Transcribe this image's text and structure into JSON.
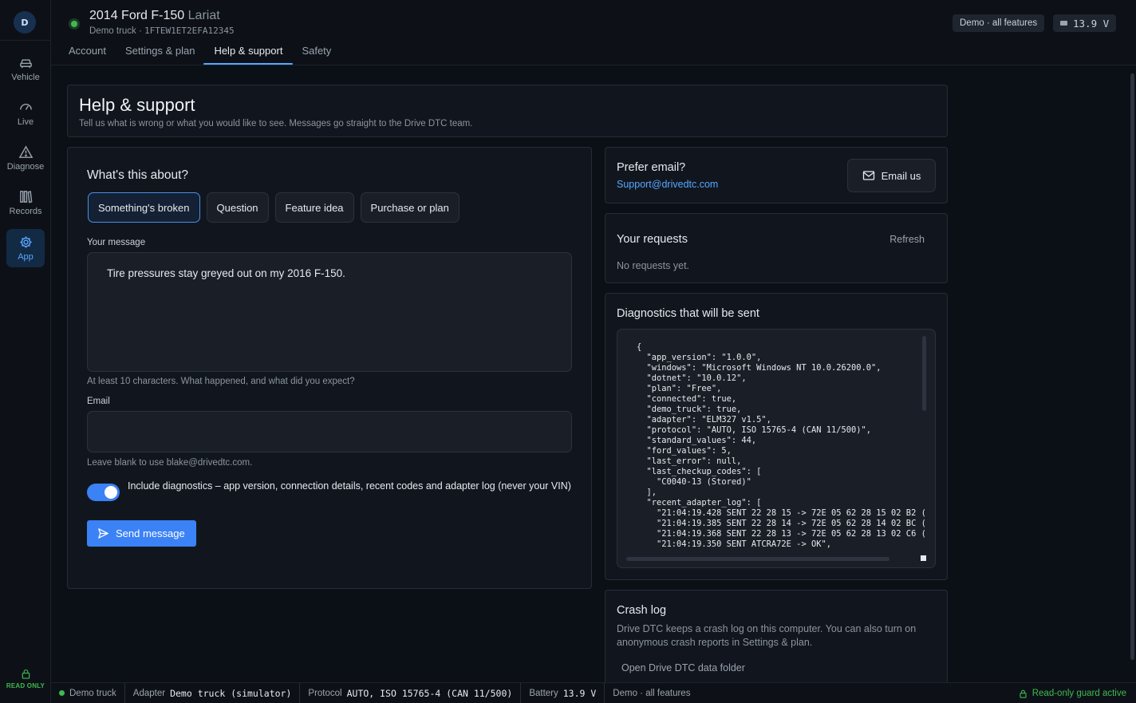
{
  "rail": {
    "logo_text": "D",
    "items": [
      {
        "label": "Vehicle",
        "icon": "car-icon"
      },
      {
        "label": "Live",
        "icon": "gauge-icon"
      },
      {
        "label": "Diagnose",
        "icon": "warning-triangle-icon"
      },
      {
        "label": "Records",
        "icon": "books-icon"
      },
      {
        "label": "App",
        "icon": "gear-icon",
        "active": true
      }
    ],
    "read_only_label": "READ ONLY"
  },
  "header": {
    "vehicle_name": "2014 Ford F-150",
    "trim": "Lariat",
    "sub_label": "Demo truck",
    "vin": "1FTEW1ET2EFA12345",
    "connected_color": "#3fb950",
    "tabs": [
      {
        "label": "Account"
      },
      {
        "label": "Settings & plan"
      },
      {
        "label": "Help & support",
        "active": true
      },
      {
        "label": "Safety"
      }
    ],
    "mode_pill": "Demo · all features",
    "voltage": "13.9 V"
  },
  "page": {
    "title": "Help & support",
    "subtitle": "Tell us what is wrong or what you would like to see. Messages go straight to the Drive DTC team."
  },
  "form": {
    "heading": "What's this about?",
    "categories": [
      {
        "label": "Something's broken",
        "selected": true
      },
      {
        "label": "Question"
      },
      {
        "label": "Feature idea"
      },
      {
        "label": "Purchase or plan"
      }
    ],
    "message_label": "Your message",
    "message_value": "Tire pressures stay greyed out on my 2016 F-150.",
    "message_hint": "At least 10 characters. What happened, and what did you expect?",
    "email_label": "Email",
    "email_value": "",
    "email_hint": "Leave blank to use blake@drivedtc.com.",
    "include_diagnostics": true,
    "include_diagnostics_label": "Include diagnostics – app version, connection details, recent codes and adapter log (never your VIN)",
    "send_label": "Send message",
    "accent": "#3b82f6"
  },
  "email_card": {
    "title": "Prefer email?",
    "address": "Support@drivedtc.com",
    "button_label": "Email us"
  },
  "requests": {
    "title": "Your requests",
    "refresh_label": "Refresh",
    "empty_text": "No requests yet."
  },
  "diagnostics": {
    "title": "Diagnostics that will be sent",
    "json_text": "{\n  \"app_version\": \"1.0.0\",\n  \"windows\": \"Microsoft Windows NT 10.0.26200.0\",\n  \"dotnet\": \"10.0.12\",\n  \"plan\": \"Free\",\n  \"connected\": true,\n  \"demo_truck\": true,\n  \"adapter\": \"ELM327 v1.5\",\n  \"protocol\": \"AUTO, ISO 15765-4 (CAN 11/500)\",\n  \"standard_values\": 44,\n  \"ford_values\": 5,\n  \"last_error\": null,\n  \"last_checkup_codes\": [\n    \"C0040-13 (Stored)\"\n  ],\n  \"recent_adapter_log\": [\n    \"21:04:19.428 SENT 22 28 15 -> 72E 05 62 28 15 02 B2 (\n    \"21:04:19.385 SENT 22 28 14 -> 72E 05 62 28 14 02 BC (\n    \"21:04:19.368 SENT 22 28 13 -> 72E 05 62 28 13 02 C6 (\n    \"21:04:19.350 SENT ATCRA72E -> OK\","
  },
  "crash": {
    "title": "Crash log",
    "description": "Drive DTC keeps a crash log on this computer. You can also turn on anonymous crash reports in Settings & plan.",
    "open_folder_label": "Open Drive DTC data folder"
  },
  "status_bar": {
    "vehicle": "Demo truck",
    "adapter_label": "Adapter",
    "adapter_value": "Demo truck (simulator)",
    "protocol_label": "Protocol",
    "protocol_value": "AUTO, ISO 15765-4 (CAN 11/500)",
    "battery_label": "Battery",
    "battery_value": "13.9 V",
    "mode": "Demo · all features",
    "guard": "Read-only guard active"
  }
}
